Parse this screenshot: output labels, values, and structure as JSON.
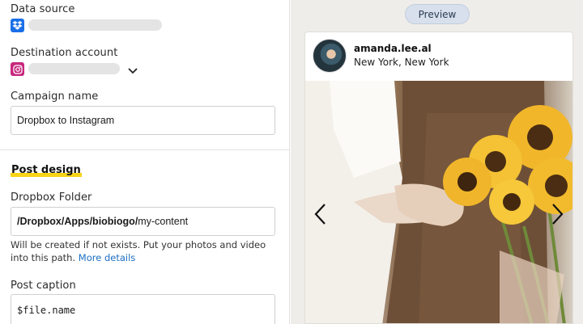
{
  "form": {
    "data_source_label": "Data source",
    "destination_label": "Destination account",
    "campaign_name_label": "Campaign name",
    "campaign_name_value": "Dropbox to Instagram",
    "post_design_title": "Post design",
    "dropbox_folder_label": "Dropbox Folder",
    "folder_prefix": "/Dropbox/Apps/biobiogo/",
    "folder_value": "my-content",
    "folder_helper": "Will be created if not exists. Put your photos and video into this path.",
    "more_details_link": "More details",
    "post_caption_label": "Post caption",
    "post_caption_value": "$file.name"
  },
  "preview": {
    "button_label": "Preview",
    "username": "amanda.lee.al",
    "location": "New York, New York"
  },
  "icons": [
    "dropbox-icon",
    "instagram-icon",
    "chevron-down-icon",
    "chevron-left-icon",
    "chevron-right-icon"
  ],
  "colors": {
    "accent_highlight": "#f7d417",
    "link": "#1a6fc4",
    "dropbox": "#1a6fe8",
    "instagram": "#c8287d",
    "preview_panel_bg": "#efede9"
  }
}
